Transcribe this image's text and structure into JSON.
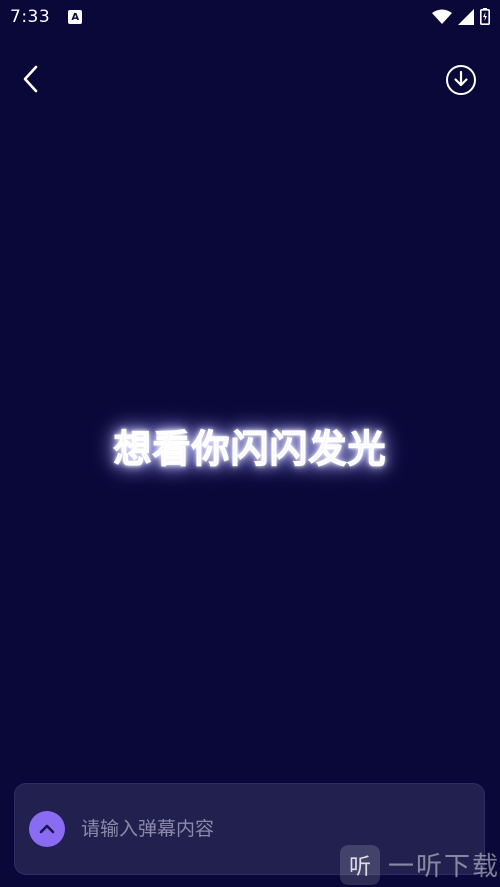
{
  "status_bar": {
    "time": "7:33",
    "notification_icon": "a-icon",
    "right_icons": [
      "wifi-icon",
      "signal-icon",
      "battery-icon"
    ]
  },
  "header": {
    "back_icon": "chevron-left-icon",
    "download_icon": "download-circle-icon"
  },
  "display": {
    "text": "想看你闪闪发光",
    "glow_color": "#b9b9ff"
  },
  "input_bar": {
    "placeholder": "请输入弹幕内容",
    "value": "",
    "toggle_icon": "chevron-up-icon",
    "toggle_color": "#8a6cf2"
  },
  "watermark": {
    "logo_char": "听",
    "text": "一听下载"
  },
  "colors": {
    "background": "#0a0838",
    "input_bg": "#22204f"
  }
}
